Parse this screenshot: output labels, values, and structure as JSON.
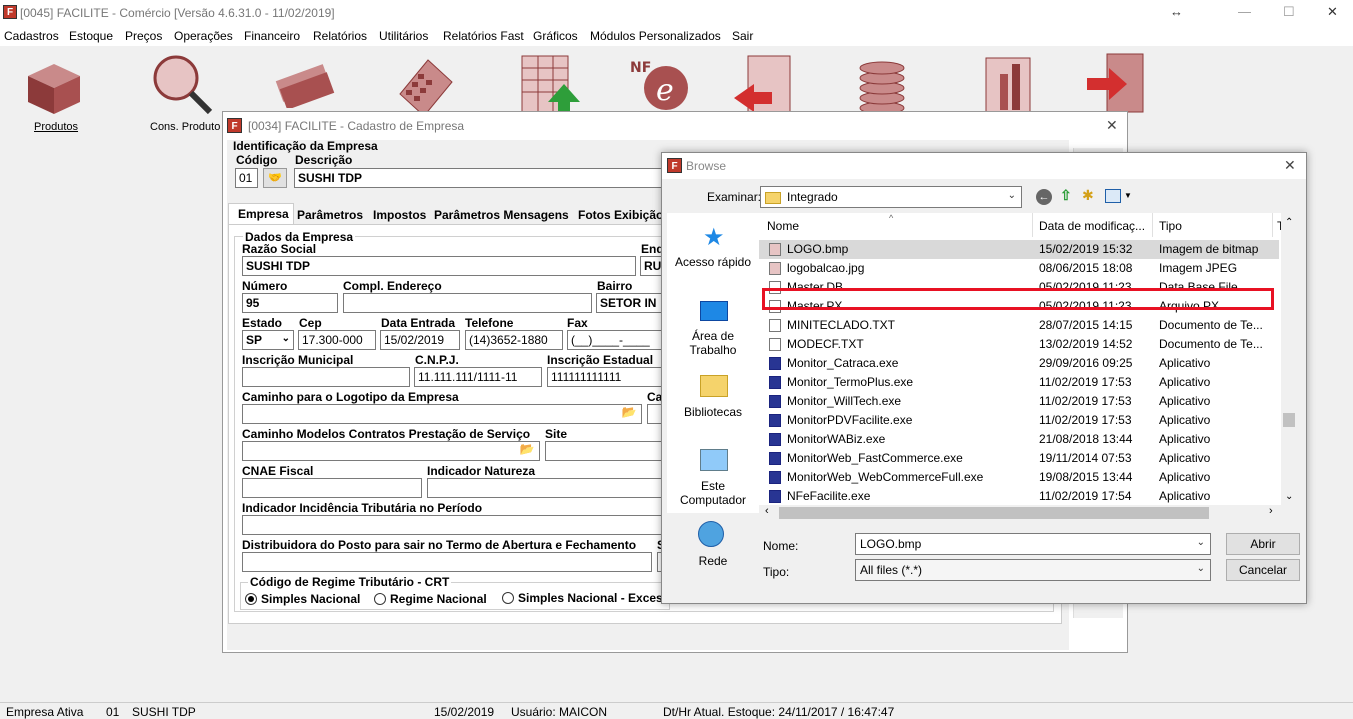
{
  "app": {
    "title": "[0045] FACILITE - Comércio [Versão 4.6.31.0 - 11/02/2019]",
    "logo": "F"
  },
  "menu": [
    "Cadastros",
    "Estoque",
    "Preços",
    "Operações",
    "Financeiro",
    "Relatórios",
    "Utilitários",
    "Relatórios Fast",
    "Gráficos",
    "Módulos Personalizados",
    "Sair"
  ],
  "toolbar": {
    "produtos": "Produtos",
    "cons_produto": "Cons. Produto"
  },
  "cadastro": {
    "title": "[0034] FACILITE - Cadastro de Empresa",
    "ident_label": "Identificação da Empresa",
    "codigo_label": "Código",
    "codigo": "01",
    "descricao_label": "Descrição",
    "descricao": "SUSHI TDP",
    "tabs": [
      "Empresa",
      "Parâmetros",
      "Impostos",
      "Parâmetros Mensagens",
      "Fotos Exibição"
    ],
    "dados_label": "Dados da Empresa",
    "razao_label": "Razão Social",
    "razao": "SUSHI TDP",
    "end_label": "End",
    "end": "RU",
    "numero_label": "Número",
    "numero": "95",
    "compl_label": "Compl. Endereço",
    "compl": "",
    "bairro_label": "Bairro",
    "bairro": "SETOR IN",
    "estado_label": "Estado",
    "estado": "SP",
    "cep_label": "Cep",
    "cep": "17.300-000",
    "data_label": "Data Entrada",
    "data": "15/02/2019",
    "tel_label": "Telefone",
    "tel": "(14)3652-1880",
    "fax_label": "Fax",
    "fax": "(__)____-____",
    "insc_mun_label": "Inscrição Municipal",
    "cnpj_label": "C.N.P.J.",
    "cnpj": "11.111.111/1111-11",
    "insc_est_label": "Inscrição Estadual",
    "insc_est": "111111111111",
    "logo_path_label": "Caminho para o Logotipo da Empresa",
    "ca_label": "Ca",
    "contratos_label": "Caminho Modelos Contratos Prestação de Serviço",
    "site_label": "Site",
    "cnae_label": "CNAE Fiscal",
    "ind_nat_label": "Indicador Natureza",
    "ind_inc_label": "Indicador Incidência Tributária no Período",
    "distrib_label": "Distribuidora do Posto para sair no Termo de Abertura e Fechamento",
    "s_label": "S",
    "crt_label": "Código de Regime Tributário - CRT",
    "crt_opts": [
      "Simples Nacional",
      "Regime Nacional",
      "Simples Nacional - Exces"
    ]
  },
  "browse": {
    "title": "Browse",
    "examinar_label": "Examinar:",
    "folder": "Integrado",
    "places": [
      "Acesso rápido",
      "Área de\nTrabalho",
      "Bibliotecas",
      "Este\nComputador",
      "Rede"
    ],
    "columns": [
      "Nome",
      "Data de modificaç...",
      "Tipo",
      "T"
    ],
    "files": [
      {
        "name": "LOGO.bmp",
        "date": "15/02/2019 15:32",
        "type": "Imagem de bitmap",
        "icon": "bitmap-icon"
      },
      {
        "name": "logobalcao.jpg",
        "date": "08/06/2015 18:08",
        "type": "Imagem JPEG",
        "icon": "image-icon"
      },
      {
        "name": "Master.DB",
        "date": "05/02/2019 11:23",
        "type": "Data Base File",
        "icon": "file-icon"
      },
      {
        "name": "Master.PX",
        "date": "05/02/2019 11:23",
        "type": "Arquivo PX",
        "icon": "file-icon"
      },
      {
        "name": "MINITECLADO.TXT",
        "date": "28/07/2015 14:15",
        "type": "Documento de Te...",
        "icon": "text-file-icon"
      },
      {
        "name": "MODECF.TXT",
        "date": "13/02/2019 14:52",
        "type": "Documento de Te...",
        "icon": "text-file-icon"
      },
      {
        "name": "Monitor_Catraca.exe",
        "date": "29/09/2016 09:25",
        "type": "Aplicativo",
        "icon": "app-icon"
      },
      {
        "name": "Monitor_TermoPlus.exe",
        "date": "11/02/2019 17:53",
        "type": "Aplicativo",
        "icon": "app-icon"
      },
      {
        "name": "Monitor_WillTech.exe",
        "date": "11/02/2019 17:53",
        "type": "Aplicativo",
        "icon": "app-icon"
      },
      {
        "name": "MonitorPDVFacilite.exe",
        "date": "11/02/2019 17:53",
        "type": "Aplicativo",
        "icon": "app-icon"
      },
      {
        "name": "MonitorWABiz.exe",
        "date": "21/08/2018 13:44",
        "type": "Aplicativo",
        "icon": "app-icon"
      },
      {
        "name": "MonitorWeb_FastCommerce.exe",
        "date": "19/11/2014 07:53",
        "type": "Aplicativo",
        "icon": "app-icon"
      },
      {
        "name": "MonitorWeb_WebCommerceFull.exe",
        "date": "19/08/2015 13:44",
        "type": "Aplicativo",
        "icon": "app-icon"
      },
      {
        "name": "NFeFacilite.exe",
        "date": "11/02/2019 17:54",
        "type": "Aplicativo",
        "icon": "app-icon"
      }
    ],
    "nome_label": "Nome:",
    "nome": "LOGO.bmp",
    "tipo_label": "Tipo:",
    "tipo": "All files (*.*)",
    "abrir": "Abrir",
    "cancelar": "Cancelar"
  },
  "status": {
    "empresa_ativa": "Empresa Ativa",
    "codigo": "01",
    "nome": "SUSHI TDP",
    "data": "15/02/2019",
    "usuario": "Usuário: MAICON",
    "estoque": "Dt/Hr Atual. Estoque: 24/11/2017 / 16:47:47"
  },
  "colors": {
    "highlight": "#e81123",
    "selected_row": "#d9d9d9"
  }
}
